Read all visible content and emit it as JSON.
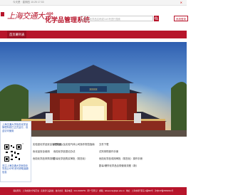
{
  "topbar": {
    "date": "今天是 · 星期四 10:25 17:33",
    "close": "✕"
  },
  "header": {
    "logo_text": "上海交通大学",
    "system_title": "化学品管理系统",
    "search_placeholder": "请输入化学品名称或CAS号进行搜索",
    "login_label": "系统登录"
  },
  "nav": {
    "tab_label": "首页幕列表"
  },
  "float_ad": {
    "text_top": "上海交通大学危险化学品管理系统已正式运行，欢迎访问使用",
    "text_bottom": "关注上海交通大学危险化学品公众号 即可获取最新信息"
  },
  "content": {
    "col1": [
      "实验室化学品安全管理制度",
      "危化品安全使用",
      "危险化学品采购流程"
    ],
    "col2": [
      "化学品以及实验气体公司操作规范指南",
      "危险化学品登记办法",
      "剧毒化学品购买审批（常态化）"
    ],
    "col3": [
      "化学品管理手册",
      "实验室危险品安全操作手册",
      "危险化学品采购审批（常态化）操作手册"
    ],
    "col4": [
      "文件下载",
      "试剂采购操作手册",
      "危险化学品领用审批（常态化）操作手册",
      "剧毒/爆炸化学品合规使用流程（新）"
    ]
  },
  "footer": {
    "text": "版权所有：上海交通大学保卫处 · 实验室与设备处 · 技术支持：联系电话：021-34206751（周一至周五） 邮箱：labsecurity@sjtu.edu.cn · 地址：上海市闵行区东川路800号 · 沪交ICP备05052011号"
  }
}
